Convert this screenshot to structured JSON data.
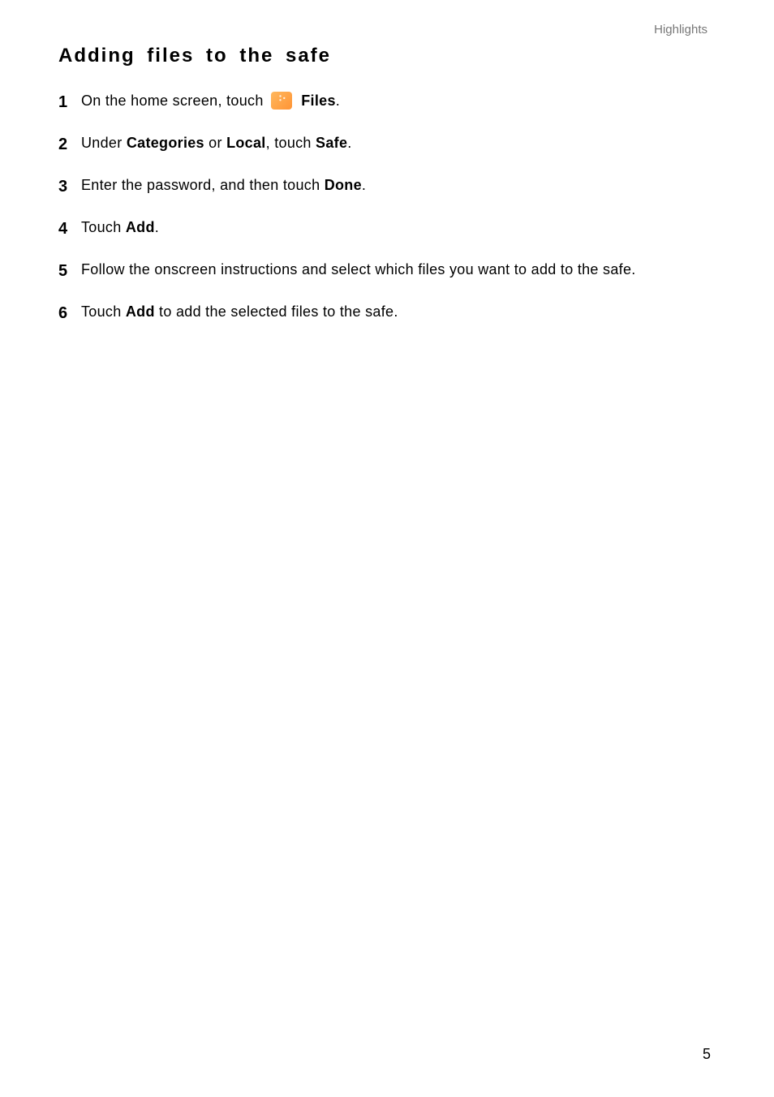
{
  "header": {
    "section_label": "Highlights"
  },
  "title": "Adding files to the safe",
  "steps": [
    {
      "number": "1",
      "parts": [
        {
          "type": "text",
          "value": "On the home screen, touch "
        },
        {
          "type": "icon",
          "name": "files-app-icon"
        },
        {
          "type": "text",
          "value": " "
        },
        {
          "type": "bold",
          "value": "Files"
        },
        {
          "type": "text",
          "value": "."
        }
      ]
    },
    {
      "number": "2",
      "parts": [
        {
          "type": "text",
          "value": "Under "
        },
        {
          "type": "bold",
          "value": "Categories"
        },
        {
          "type": "text",
          "value": " or "
        },
        {
          "type": "bold",
          "value": "Local"
        },
        {
          "type": "text",
          "value": ", touch "
        },
        {
          "type": "bold",
          "value": "Safe"
        },
        {
          "type": "text",
          "value": "."
        }
      ]
    },
    {
      "number": "3",
      "parts": [
        {
          "type": "text",
          "value": "Enter the password, and then touch "
        },
        {
          "type": "bold",
          "value": "Done"
        },
        {
          "type": "text",
          "value": "."
        }
      ]
    },
    {
      "number": "4",
      "parts": [
        {
          "type": "text",
          "value": "Touch "
        },
        {
          "type": "bold",
          "value": "Add"
        },
        {
          "type": "text",
          "value": "."
        }
      ]
    },
    {
      "number": "5",
      "parts": [
        {
          "type": "text",
          "value": "Follow the onscreen instructions and select which files you want to add to the safe."
        }
      ]
    },
    {
      "number": "6",
      "parts": [
        {
          "type": "text",
          "value": "Touch "
        },
        {
          "type": "bold",
          "value": "Add"
        },
        {
          "type": "text",
          "value": " to add the selected files to the safe."
        }
      ]
    }
  ],
  "page_number": "5"
}
